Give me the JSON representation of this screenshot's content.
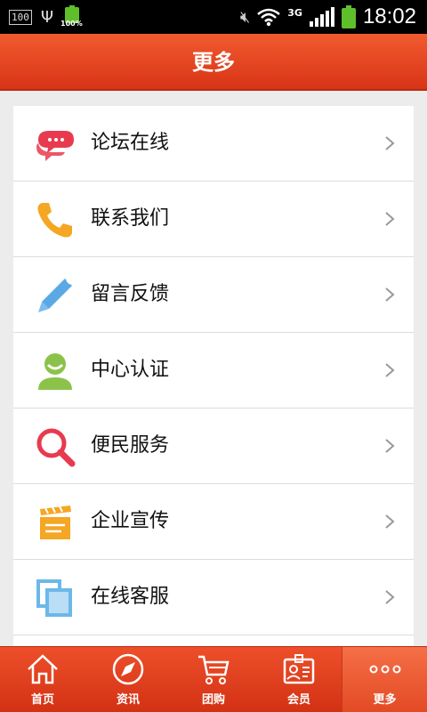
{
  "status_bar": {
    "left_box": "100",
    "battery_small_pct": "100%",
    "network": "3G",
    "time": "18:02",
    "battery_color": "#5fbf2a"
  },
  "header": {
    "title": "更多",
    "color": "#e2401e"
  },
  "menu": {
    "items": [
      {
        "label": "论坛在线",
        "icon": "chat-bubbles-icon"
      },
      {
        "label": "联系我们",
        "icon": "phone-icon"
      },
      {
        "label": "留言反馈",
        "icon": "pencil-icon"
      },
      {
        "label": "中心认证",
        "icon": "user-icon"
      },
      {
        "label": "便民服务",
        "icon": "magnifier-icon"
      },
      {
        "label": "企业宣传",
        "icon": "clapperboard-icon"
      },
      {
        "label": "在线客服",
        "icon": "copy-pages-icon"
      }
    ]
  },
  "tab_bar": {
    "tabs": [
      {
        "label": "首页",
        "icon": "home-icon"
      },
      {
        "label": "资讯",
        "icon": "compass-icon"
      },
      {
        "label": "团购",
        "icon": "cart-icon"
      },
      {
        "label": "会员",
        "icon": "member-card-icon"
      },
      {
        "label": "更多",
        "icon": "more-dots-icon",
        "active": true
      }
    ]
  }
}
